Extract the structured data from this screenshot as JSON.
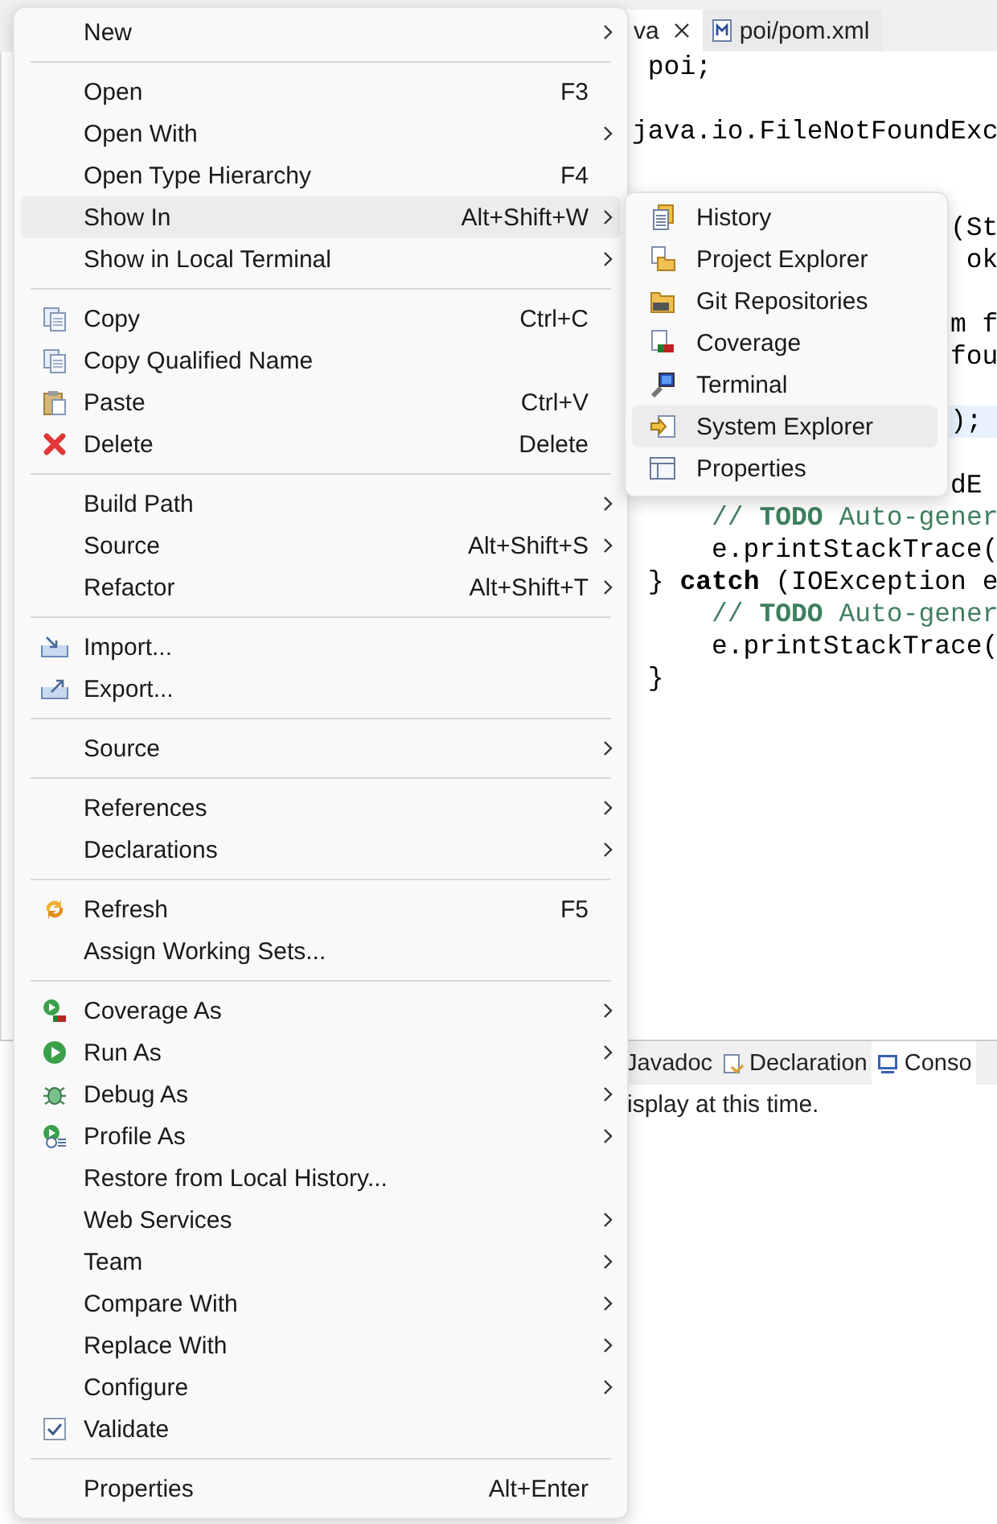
{
  "editor_tabs": [
    {
      "label": "va",
      "closable": true,
      "selected": true
    },
    {
      "label": "poi/pom.xml",
      "closable": false,
      "selected": false
    }
  ],
  "code_lines": [
    {
      "kind": "full",
      "text": " poi;",
      "current": false
    },
    {
      "kind": "blank",
      "current": false
    },
    {
      "kind": "full",
      "text": "java.io.FileNotFoundExc",
      "current": false
    },
    {
      "kind": "blank",
      "current": false
    },
    {
      "kind": "blank",
      "current": false
    },
    {
      "kind": "tail",
      "text": "(St",
      "current": false
    },
    {
      "kind": "tail",
      "text": " ok",
      "current": false
    },
    {
      "kind": "blank",
      "current": false
    },
    {
      "kind": "tail",
      "text": "m f",
      "current": false
    },
    {
      "kind": "tail",
      "text": "fou",
      "current": false
    },
    {
      "kind": "blank",
      "current": false
    },
    {
      "kind": "tail",
      "text": ");",
      "current": true
    },
    {
      "kind": "blank",
      "current": false
    },
    {
      "kind": "tail",
      "text": "dE",
      "current": false
    },
    {
      "kind": "comment",
      "text": "     // **TODO** Auto-gener",
      "current": false
    },
    {
      "kind": "full",
      "text": "     e.printStackTrace(",
      "current": false
    },
    {
      "kind": "full",
      "text": " } **catch** (IOException e",
      "current": false
    },
    {
      "kind": "comment",
      "text": "     // **TODO** Auto-gener",
      "current": false
    },
    {
      "kind": "full",
      "text": "     e.printStackTrace(",
      "current": false
    },
    {
      "kind": "full",
      "text": " }",
      "current": false
    }
  ],
  "panel_tabs": [
    {
      "label": "Javadoc",
      "selected": false
    },
    {
      "label": "Declaration",
      "selected": false
    },
    {
      "label": "Conso",
      "selected": true
    }
  ],
  "panel_message": "isplay at this time.",
  "context_menu": [
    {
      "kind": "item",
      "label": "New",
      "submenu": true,
      "selected": false
    },
    {
      "kind": "separator"
    },
    {
      "kind": "item",
      "label": "Open",
      "shortcut": "F3",
      "submenu": false,
      "selected": false
    },
    {
      "kind": "item",
      "label": "Open With",
      "submenu": true,
      "selected": false
    },
    {
      "kind": "item",
      "label": "Open Type Hierarchy",
      "shortcut": "F4",
      "submenu": false,
      "selected": false
    },
    {
      "kind": "item",
      "label": "Show In",
      "shortcut": "Alt+Shift+W",
      "submenu": true,
      "selected": true
    },
    {
      "kind": "item",
      "label": "Show in Local Terminal",
      "submenu": true,
      "selected": false
    },
    {
      "kind": "separator"
    },
    {
      "kind": "item",
      "label": "Copy",
      "shortcut": "Ctrl+C",
      "submenu": false,
      "selected": false
    },
    {
      "kind": "item",
      "label": "Copy Qualified Name",
      "submenu": false,
      "selected": false
    },
    {
      "kind": "item",
      "label": "Paste",
      "shortcut": "Ctrl+V",
      "submenu": false,
      "selected": false
    },
    {
      "kind": "item",
      "label": "Delete",
      "shortcut": "Delete",
      "submenu": false,
      "selected": false
    },
    {
      "kind": "separator"
    },
    {
      "kind": "item",
      "label": "Build Path",
      "submenu": true,
      "selected": false
    },
    {
      "kind": "item",
      "label": "Source",
      "shortcut": "Alt+Shift+S",
      "submenu": true,
      "selected": false
    },
    {
      "kind": "item",
      "label": "Refactor",
      "shortcut": "Alt+Shift+T",
      "submenu": true,
      "selected": false
    },
    {
      "kind": "separator"
    },
    {
      "kind": "item",
      "label": "Import...",
      "submenu": false,
      "selected": false
    },
    {
      "kind": "item",
      "label": "Export...",
      "submenu": false,
      "selected": false
    },
    {
      "kind": "separator"
    },
    {
      "kind": "item",
      "label": "Source",
      "submenu": true,
      "selected": false
    },
    {
      "kind": "separator"
    },
    {
      "kind": "item",
      "label": "References",
      "submenu": true,
      "selected": false
    },
    {
      "kind": "item",
      "label": "Declarations",
      "submenu": true,
      "selected": false
    },
    {
      "kind": "separator"
    },
    {
      "kind": "item",
      "label": "Refresh",
      "shortcut": "F5",
      "submenu": false,
      "selected": false
    },
    {
      "kind": "item",
      "label": "Assign Working Sets...",
      "submenu": false,
      "selected": false
    },
    {
      "kind": "separator"
    },
    {
      "kind": "item",
      "label": "Coverage As",
      "submenu": true,
      "selected": false
    },
    {
      "kind": "item",
      "label": "Run As",
      "submenu": true,
      "selected": false
    },
    {
      "kind": "item",
      "label": "Debug As",
      "submenu": true,
      "selected": false
    },
    {
      "kind": "item",
      "label": "Profile As",
      "submenu": true,
      "selected": false
    },
    {
      "kind": "item",
      "label": "Restore from Local History...",
      "submenu": false,
      "selected": false
    },
    {
      "kind": "item",
      "label": "Web Services",
      "submenu": true,
      "selected": false
    },
    {
      "kind": "item",
      "label": "Team",
      "submenu": true,
      "selected": false
    },
    {
      "kind": "item",
      "label": "Compare With",
      "submenu": true,
      "selected": false
    },
    {
      "kind": "item",
      "label": "Replace With",
      "submenu": true,
      "selected": false
    },
    {
      "kind": "item",
      "label": "Configure",
      "submenu": true,
      "selected": false
    },
    {
      "kind": "item",
      "label": "Validate",
      "submenu": false,
      "selected": false,
      "checked": true
    },
    {
      "kind": "separator"
    },
    {
      "kind": "item",
      "label": "Properties",
      "shortcut": "Alt+Enter",
      "submenu": false,
      "selected": false
    }
  ],
  "show_in_submenu": [
    {
      "label": "History",
      "selected": false
    },
    {
      "label": "Project Explorer",
      "selected": false
    },
    {
      "label": "Git Repositories",
      "selected": false
    },
    {
      "label": "Coverage",
      "selected": false
    },
    {
      "label": "Terminal",
      "selected": false
    },
    {
      "label": "System Explorer",
      "selected": true
    },
    {
      "label": "Properties",
      "selected": false
    }
  ]
}
